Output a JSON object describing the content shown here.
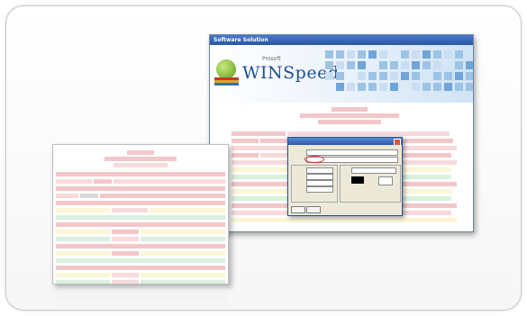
{
  "app": {
    "window_title": "Software Solution",
    "brand_prefix": "Prosoft",
    "brand_name": "WINSpeed"
  },
  "colors": {
    "report_header": "#f2c7c9",
    "report_row_alt": "#fbf6d6",
    "report_row_green": "#daf0e0",
    "titlebar": "#2a55a3"
  },
  "icons": [
    "apple-icon",
    "books-icon",
    "close-icon"
  ]
}
